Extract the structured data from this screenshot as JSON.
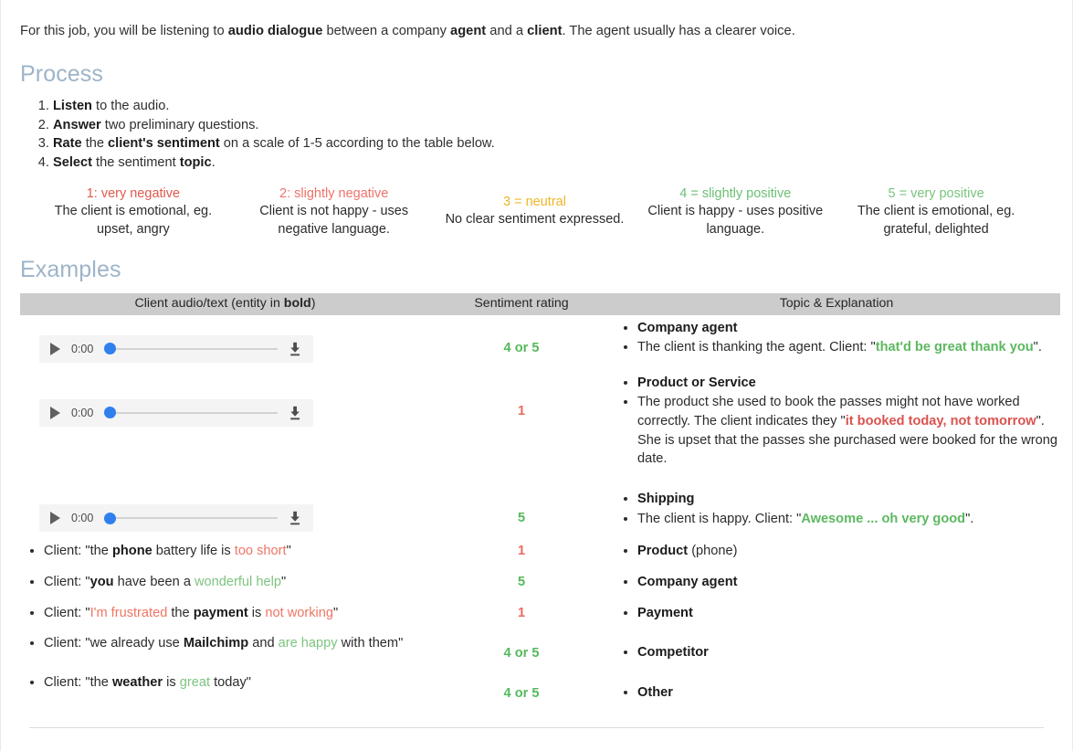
{
  "intro": {
    "part1": "For this job, you will be listening to ",
    "b1": "audio dialogue",
    "part2": " between a company ",
    "b2": "agent",
    "part3": " and a ",
    "b3": "client",
    "part4": ". The agent usually has a clearer voice."
  },
  "headings": {
    "process": "Process",
    "examples": "Examples"
  },
  "process_steps": [
    {
      "bold": "Listen",
      "rest": " to the audio."
    },
    {
      "bold": "Answer",
      "rest": " two preliminary questions."
    },
    {
      "bold": "Rate",
      "rest": " the ",
      "bold2": "client's sentiment",
      "rest2": " on a scale of 1-5 according to the table below."
    },
    {
      "bold": "Select",
      "rest": " the sentiment ",
      "bold2": "topic",
      "rest2": "."
    }
  ],
  "scale": [
    {
      "label": "1: very negative",
      "color": "#e05a4e",
      "desc": "The client is emotional, eg. upset,  angry"
    },
    {
      "label": "2: slightly negative",
      "color": "#f0726a",
      "desc": "Client is not happy - uses negative language."
    },
    {
      "label": "3 = neutral",
      "color": "#f0b429",
      "desc": "No clear sentiment expressed."
    },
    {
      "label": "4 = slightly positive",
      "color": "#6cbf73",
      "desc": "Client is happy - uses positive language."
    },
    {
      "label": "5 = very positive",
      "color": "#79c47d",
      "desc": "The client is emotional, eg. grateful, delighted"
    }
  ],
  "table": {
    "headers": {
      "client": "Client audio/text (entity in ",
      "client_bold": "bold",
      "client_end": ")",
      "rating": "Sentiment rating",
      "topic": "Topic & Explanation"
    },
    "audio_rows": [
      {
        "player": {
          "time": "0:00",
          "play_icon": "play-icon",
          "download_icon": "download-icon"
        },
        "rating": "4 or 5",
        "rating_tone": "positive",
        "topic": "Company agent",
        "explanation_pre": "The client is thanking the agent. Client: \"",
        "explanation_quote": "that'd be great thank you",
        "explanation_post": "\".",
        "quote_tone": "positive"
      },
      {
        "player": {
          "time": "0:00",
          "play_icon": "play-icon",
          "download_icon": "download-icon"
        },
        "rating": "1",
        "rating_tone": "negative",
        "topic": "Product or Service",
        "explanation_pre": "The product she used to book the passes might not have worked correctly. The client indicates they \"",
        "explanation_quote": "it booked today, not tomorrow",
        "explanation_post": "\". She is upset that the passes she purchased were booked for the wrong date.",
        "quote_tone": "negative"
      },
      {
        "player": {
          "time": "0:00",
          "play_icon": "play-icon",
          "download_icon": "download-icon"
        },
        "rating": "5",
        "rating_tone": "positive",
        "topic": "Shipping",
        "explanation_pre": "The client is happy. Client: \"",
        "explanation_quote": "Awesome ... oh very good",
        "explanation_post": "\".",
        "quote_tone": "positive"
      }
    ],
    "text_rows": [
      {
        "client_pre": "Client: \"the ",
        "client_bold": "phone",
        "client_mid": " battery life is ",
        "client_hl": "too short",
        "client_post": "\"",
        "hl_tone": "negative",
        "rating": "1",
        "rating_tone": "negative",
        "topic_bold": "Product",
        "topic_rest": " (phone)"
      },
      {
        "client_pre": "Client: \"",
        "client_bold": "you",
        "client_mid": " have been a ",
        "client_hl": "wonderful help",
        "client_post": "\"",
        "hl_tone": "positive",
        "rating": "5",
        "rating_tone": "positive",
        "topic_bold": "Company agent",
        "topic_rest": ""
      },
      {
        "client_pre": "Client: \"",
        "client_hl_lead": "I'm frustrated",
        "client_mid": " the ",
        "client_bold": "payment",
        "client_mid2": " is ",
        "client_hl": "not working",
        "client_post": "\"",
        "hl_tone": "negative",
        "rating": "1",
        "rating_tone": "negative",
        "topic_bold": "Payment",
        "topic_rest": ""
      },
      {
        "client_pre": "Client: \"we already use ",
        "client_bold": "Mailchimp",
        "client_mid": " and ",
        "client_hl": "are happy",
        "client_post": " with them\"",
        "hl_tone": "positive",
        "rating": "4 or 5",
        "rating_tone": "positive",
        "topic_bold": "Competitor",
        "topic_rest": ""
      },
      {
        "client_pre": "Client: \"the ",
        "client_bold": "weather",
        "client_mid": " is ",
        "client_hl": "great",
        "client_post": " today\"",
        "hl_tone": "positive",
        "rating": "4  or 5",
        "rating_tone": "positive",
        "topic_bold": "Other",
        "topic_rest": ""
      }
    ]
  },
  "colors": {
    "heading": "#9db4c9",
    "header_band": "#cccccc",
    "positive_bold": "#5cb860",
    "negative_bold": "#d9534f",
    "positive_soft": "#7dc47f",
    "negative_soft": "#ef7564",
    "slider_knob": "#2f80ed",
    "player_bg": "#f4f4f4"
  }
}
